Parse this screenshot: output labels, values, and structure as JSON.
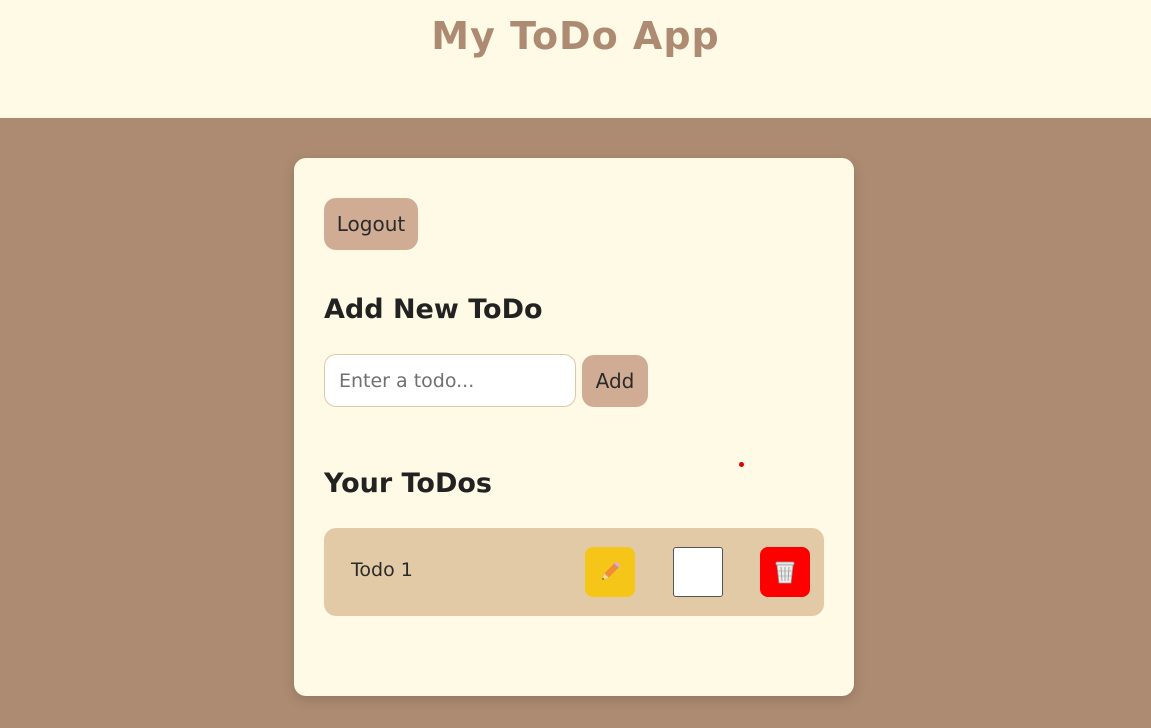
{
  "header": {
    "title": "My ToDo App"
  },
  "card": {
    "logout_label": "Logout",
    "add_title": "Add New ToDo",
    "input": {
      "placeholder": "Enter a todo...",
      "value": ""
    },
    "add_label": "Add",
    "list_title": "Your ToDos",
    "todos": [
      {
        "text": "Todo 1",
        "completed": false,
        "edit_icon": "pencil-icon",
        "delete_icon": "wastebasket-icon"
      }
    ]
  },
  "colors": {
    "page_background": "#ad8b72",
    "header_background": "#fffae6",
    "card_background": "#fffae6",
    "button_background": "#d1ac94",
    "todo_row_background": "#e3caa7",
    "edit_button": "#f5c518",
    "delete_button": "#ff0000"
  }
}
